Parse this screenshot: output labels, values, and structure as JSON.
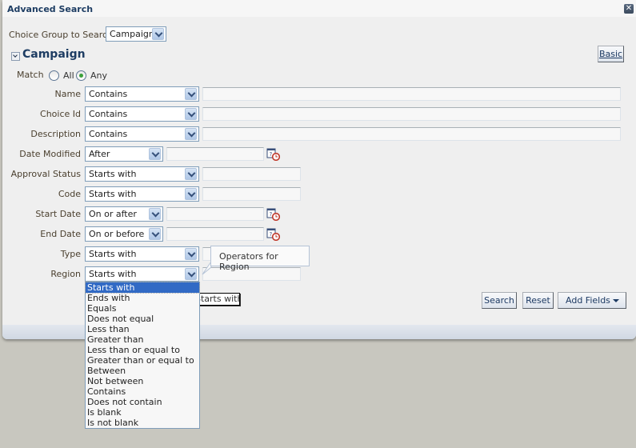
{
  "dialog": {
    "title": "Advanced Search",
    "close_icon": "close-icon"
  },
  "choice_group": {
    "label": "Choice Group to Search",
    "value": "Campaign"
  },
  "section": {
    "title": "Campaign",
    "basic_button": "Basic"
  },
  "match": {
    "label": "Match",
    "options": [
      "All",
      "Any"
    ],
    "selected": "Any"
  },
  "fields": [
    {
      "label": "Name",
      "operator": "Contains",
      "value": ""
    },
    {
      "label": "Choice Id",
      "operator": "Contains",
      "value": ""
    },
    {
      "label": "Description",
      "operator": "Contains",
      "value": ""
    },
    {
      "label": "Date Modified",
      "operator": "After",
      "value": "",
      "calendar_icon": "calendar-clock-icon"
    },
    {
      "label": "Approval Status",
      "operator": "Starts with",
      "value": ""
    },
    {
      "label": "Code",
      "operator": "Starts with",
      "value": ""
    },
    {
      "label": "Start Date",
      "operator": "On or after",
      "value": "",
      "calendar_icon": "calendar-clock-icon"
    },
    {
      "label": "End Date",
      "operator": "On or before",
      "value": "",
      "calendar_icon": "calendar-clock-icon"
    },
    {
      "label": "Type",
      "operator": "Starts with",
      "value": ""
    },
    {
      "label": "Region",
      "operator": "Starts with",
      "value": ""
    }
  ],
  "tooltip": {
    "text": "Operators for Region",
    "hover_text": "Starts with"
  },
  "region_dropdown": {
    "selected": "Starts with",
    "options": [
      "Starts with",
      "Ends with",
      "Equals",
      "Does not equal",
      "Less than",
      "Greater than",
      "Less than or equal to",
      "Greater than or equal to",
      "Between",
      "Not between",
      "Contains",
      "Does not contain",
      "Is blank",
      "Is not blank"
    ]
  },
  "actions": {
    "search": "Search",
    "reset": "Reset",
    "add_fields": "Add Fields"
  }
}
